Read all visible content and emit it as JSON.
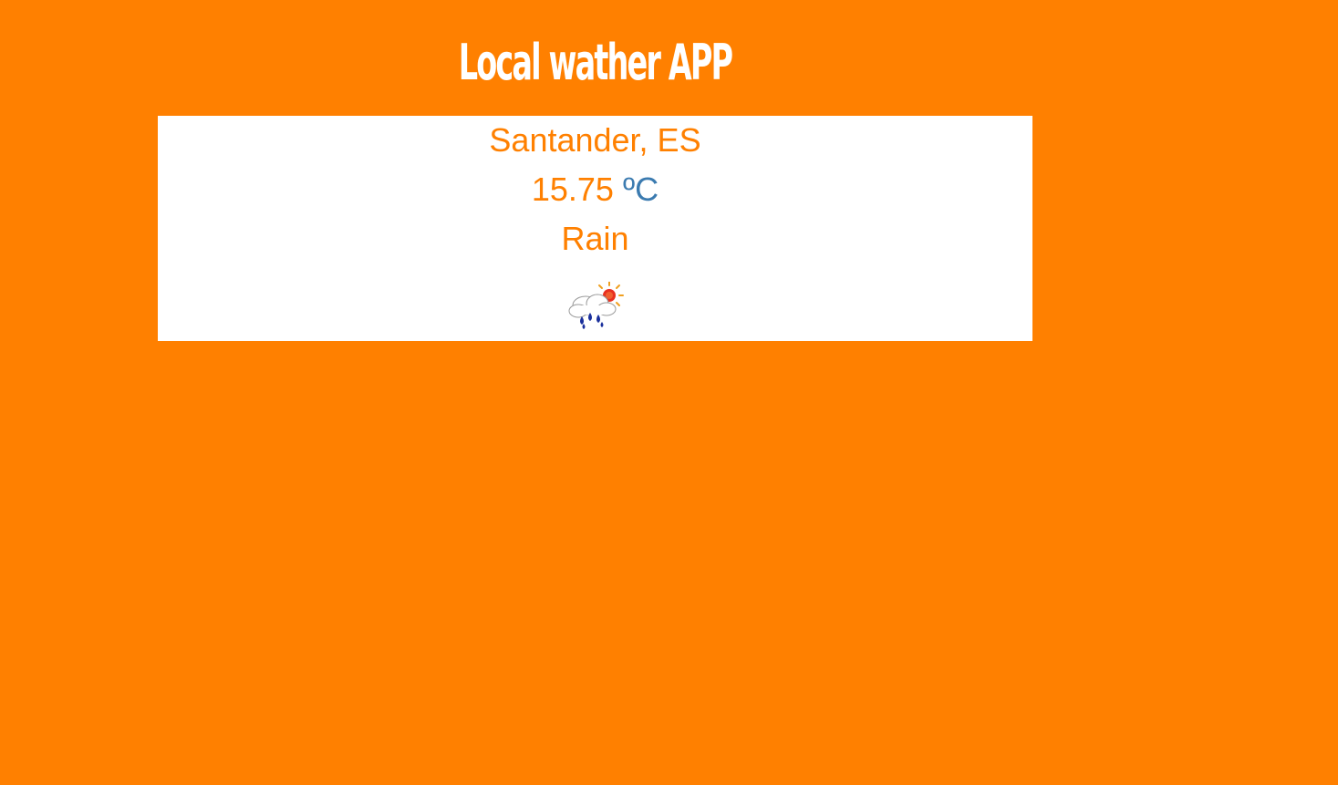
{
  "app": {
    "title": "Local wather APP"
  },
  "weather": {
    "location": "Santander, ES",
    "temperature": "15.75",
    "unit": "ºC",
    "condition": "Rain",
    "icon": "rain-sun-icon"
  },
  "colors": {
    "background": "#ff8000",
    "card": "#ffffff",
    "accent_text": "#ff8000",
    "unit_text": "#3b7bb0"
  }
}
